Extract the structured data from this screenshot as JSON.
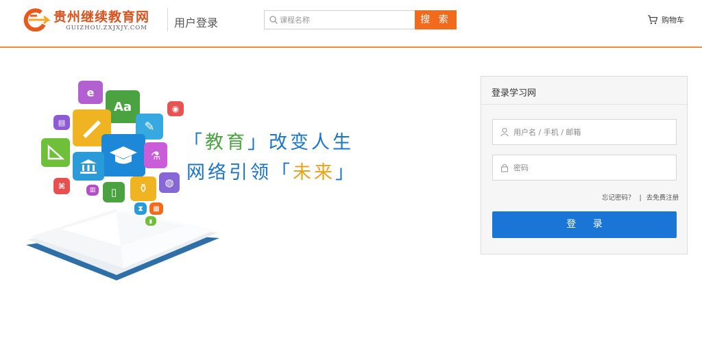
{
  "header": {
    "logo_title": "贵州继续教育网",
    "logo_subtitle": "GUIZHOU.ZXJXJY.COM",
    "page_title": "用户登录",
    "search_placeholder": "课程名称",
    "search_button": "搜 索",
    "cart_label": "购物车"
  },
  "hero": {
    "slogan_line1_open": "「",
    "slogan_line1_highlight": "教育",
    "slogan_line1_close": "」",
    "slogan_line1_rest": "改变人生",
    "slogan_line2_start": "网络引领",
    "slogan_line2_open": "「",
    "slogan_line2_highlight": "未来",
    "slogan_line2_close": "」",
    "tile_e": "e",
    "tile_aa": "Aa"
  },
  "login": {
    "title": "登录学习网",
    "username_placeholder": "用户名 / 手机 / 邮箱",
    "password_placeholder": "密码",
    "forgot_link": "忘记密码？",
    "divider": "|",
    "register_link": "去免费注册",
    "submit_label": "登 录"
  },
  "colors": {
    "brand_orange": "#f26b1d",
    "header_border": "#f08a3c",
    "login_blue": "#1a75d6",
    "slogan_blue": "#1a73c6",
    "slogan_accent": "#e8a21b"
  }
}
